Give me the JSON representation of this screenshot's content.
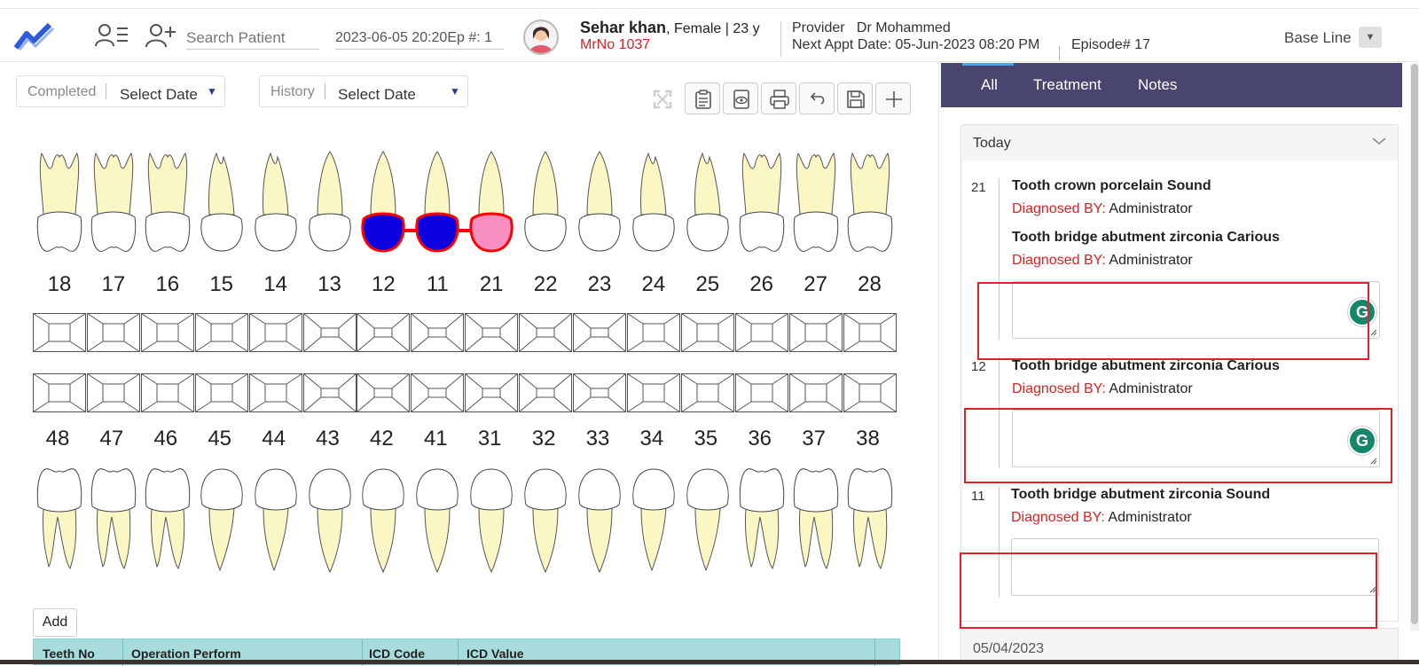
{
  "header": {
    "search_placeholder": "Search Patient",
    "date_episode": "2023-06-05 20:20Ep #: 1",
    "patient_name": "Sehar khan",
    "patient_info": ", Female | 23 y",
    "mrno": "MrNo 1037",
    "provider_label": "Provider",
    "provider_name": "Dr Mohammed",
    "next_appt_label": "Next Appt Date:",
    "next_appt_value": "05-Jun-2023 08:20 PM",
    "episode": "Episode# 17",
    "baseline": "Base Line"
  },
  "filters": {
    "completed_label": "Completed",
    "completed_value": "Select Date",
    "history_label": "History",
    "history_value": "Select Date"
  },
  "chart": {
    "upper_numbers": [
      "18",
      "17",
      "16",
      "15",
      "14",
      "13",
      "12",
      "11",
      "21",
      "22",
      "23",
      "24",
      "25",
      "26",
      "27",
      "28"
    ],
    "lower_numbers": [
      "48",
      "47",
      "46",
      "45",
      "44",
      "43",
      "42",
      "41",
      "31",
      "32",
      "33",
      "34",
      "35",
      "36",
      "37",
      "38"
    ],
    "add_label": "Add",
    "marked_teeth": {
      "12": "#0a00e0",
      "11": "#0a00e0",
      "21": "#f78fc0"
    },
    "bridge_color": "#ff0000"
  },
  "table": {
    "headers": [
      "Teeth No",
      "Operation Perform",
      "ICD Code",
      "ICD Value"
    ]
  },
  "tabs": [
    "All",
    "Treatment",
    "Notes"
  ],
  "notes": {
    "section_title": "Today",
    "diagnosed_label": "Diagnosed BY:",
    "entries": [
      {
        "tooth": "21",
        "items": [
          {
            "title": "Tooth crown porcelain Sound",
            "by": "Administrator"
          },
          {
            "title": "Tooth bridge abutment zirconia Carious",
            "by": "Administrator"
          }
        ]
      },
      {
        "tooth": "12",
        "items": [
          {
            "title": "Tooth bridge abutment zirconia Carious",
            "by": "Administrator"
          }
        ]
      },
      {
        "tooth": "11",
        "items": [
          {
            "title": "Tooth bridge abutment zirconia Sound",
            "by": "Administrator"
          }
        ]
      }
    ],
    "next_section": "05/04/2023",
    "grammarly": "G"
  }
}
